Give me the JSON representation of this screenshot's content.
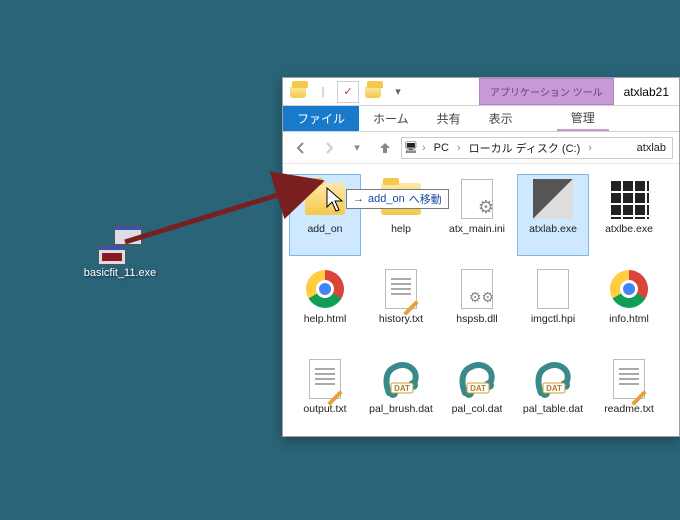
{
  "desktop": {
    "file": {
      "name": "basicfit_11.exe"
    }
  },
  "drag": {
    "ghost_label": "basicfit_11.exe",
    "tooltip_prefix": "→ ",
    "tooltip_target": "add_on",
    "tooltip_suffix": " へ移動"
  },
  "explorer": {
    "title": "atxlab21",
    "context_tab_group": "アプリケーション ツール",
    "tabs": {
      "file": "ファイル",
      "home": "ホーム",
      "share": "共有",
      "view": "表示",
      "manage": "管理"
    },
    "breadcrumb": [
      "PC",
      "ローカル ディスク (C:)",
      "atxlab"
    ],
    "items": [
      {
        "name": "add_on",
        "kind": "folder",
        "state": "drop-target"
      },
      {
        "name": "help",
        "kind": "folder"
      },
      {
        "name": "atx_main.ini",
        "kind": "ini"
      },
      {
        "name": "atxlab.exe",
        "kind": "exe-atxlab",
        "state": "selected"
      },
      {
        "name": "atxlbe.exe",
        "kind": "exe-atxlbe"
      },
      {
        "name": "help.html",
        "kind": "chrome"
      },
      {
        "name": "history.txt",
        "kind": "txt"
      },
      {
        "name": "hspsb.dll",
        "kind": "dll"
      },
      {
        "name": "imgctl.hpi",
        "kind": "hpi"
      },
      {
        "name": "info.html",
        "kind": "chrome"
      },
      {
        "name": "output.txt",
        "kind": "txt"
      },
      {
        "name": "pal_brush.dat",
        "kind": "dat"
      },
      {
        "name": "pal_col.dat",
        "kind": "dat"
      },
      {
        "name": "pal_table.dat",
        "kind": "dat"
      },
      {
        "name": "readme.txt",
        "kind": "txt"
      }
    ]
  }
}
